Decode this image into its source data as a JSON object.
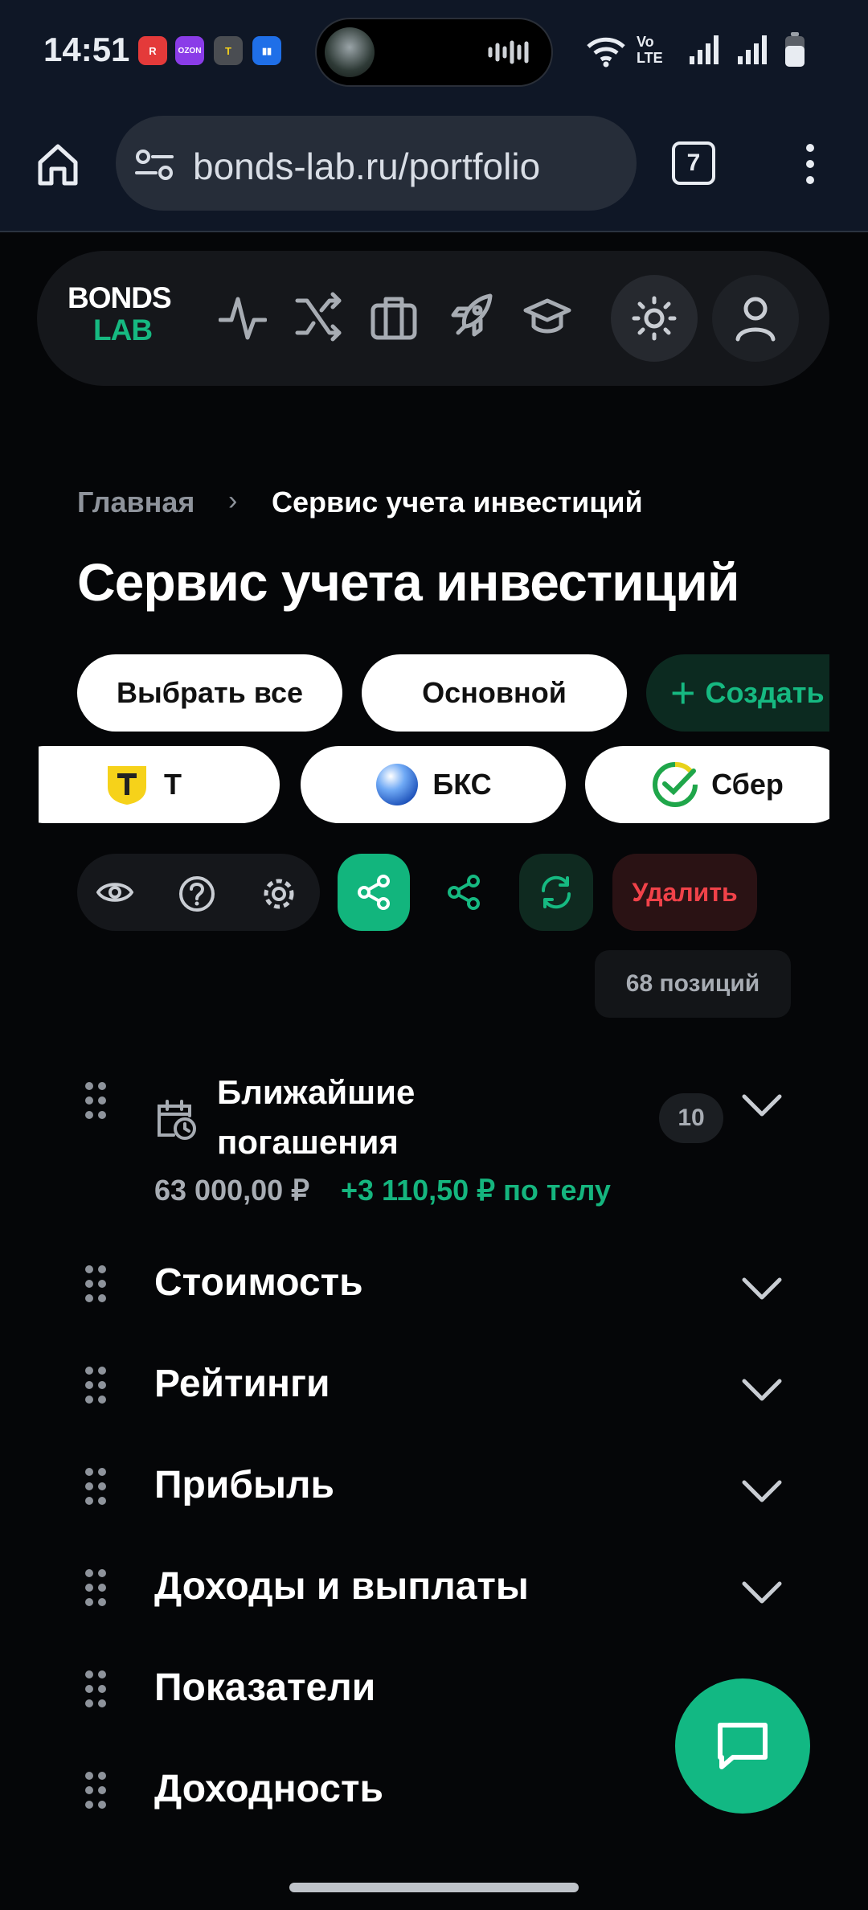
{
  "status_bar": {
    "time": "14:51",
    "apps": [
      {
        "icon": "red-app-icon",
        "label": "R",
        "color": "#e43a3a"
      },
      {
        "icon": "ozon-app-icon",
        "label": "OZON",
        "color": "#8a3ce8"
      },
      {
        "icon": "t-bank-app-icon",
        "label": "T",
        "color": "#4a4d52"
      },
      {
        "icon": "blue-app-icon",
        "label": "▮▮",
        "color": "#1f6fe8"
      }
    ],
    "network": "Vo LTE"
  },
  "browser": {
    "url": "bonds-lab.ru/portfolio",
    "tabs_count": "7"
  },
  "site": {
    "logo_top": "BONDS",
    "logo_bottom": "LAB",
    "nav_icons": [
      "activity-icon",
      "shuffle-icon",
      "briefcase-icon",
      "rocket-icon",
      "graduation-cap-icon"
    ],
    "accent_color": "#16b981"
  },
  "breadcrumb": {
    "home": "Главная",
    "separator": "›",
    "current": "Сервис учета инвестиций"
  },
  "page_title": "Сервис учета инвестиций",
  "portfolio_pills": [
    {
      "label": "Выбрать все"
    },
    {
      "label": "Основной"
    },
    {
      "label": "Создать",
      "prefix": "+"
    }
  ],
  "broker_pills": [
    {
      "label": "Т",
      "icon": "t-bank-logo-icon"
    },
    {
      "label": "БКС",
      "icon": "bks-logo-icon"
    },
    {
      "label": "Сбер",
      "icon": "sber-logo-icon"
    }
  ],
  "actions": {
    "delete_label": "Удалить",
    "positions": "68 позиций"
  },
  "nearest_redemptions": {
    "title": "Ближайшие погашения",
    "count": "10",
    "amount": "63 000,00 ₽",
    "profit": "+3 110,50 ₽ по телу"
  },
  "sections": [
    {
      "title": "Стоимость"
    },
    {
      "title": "Рейтинги"
    },
    {
      "title": "Прибыль"
    },
    {
      "title": "Доходы и выплаты"
    },
    {
      "title": "Показатели"
    },
    {
      "title": "Доходность"
    }
  ]
}
